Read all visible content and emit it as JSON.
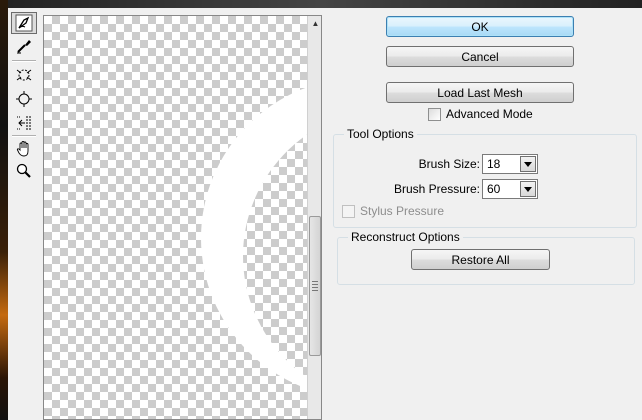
{
  "buttons": {
    "ok": "OK",
    "cancel": "Cancel",
    "load_last_mesh": "Load Last Mesh",
    "restore_all": "Restore All"
  },
  "advanced_mode": {
    "label": "Advanced Mode",
    "checked": false
  },
  "tool_options": {
    "title": "Tool Options",
    "brush_size": {
      "label": "Brush Size:",
      "value": "18"
    },
    "brush_pressure": {
      "label": "Brush Pressure:",
      "value": "60"
    },
    "stylus_pressure": {
      "label": "Stylus Pressure",
      "checked": false,
      "enabled": false
    }
  },
  "reconstruct_options": {
    "title": "Reconstruct Options"
  },
  "tools": [
    {
      "icon": "forward-warp-tool-icon",
      "active": true
    },
    {
      "icon": "reconstruct-tool-icon",
      "active": false
    },
    {
      "icon": "pucker-tool-icon",
      "active": false
    },
    {
      "icon": "bloat-tool-icon",
      "active": false
    },
    {
      "icon": "push-left-tool-icon",
      "active": false
    },
    {
      "icon": "hand-tool-icon",
      "active": false
    },
    {
      "icon": "zoom-tool-icon",
      "active": false
    }
  ],
  "colors": {
    "dialog_bg": "#f0f0f0",
    "default_button_border": "#3c7fb1",
    "checker_dark": "#cccccc"
  }
}
